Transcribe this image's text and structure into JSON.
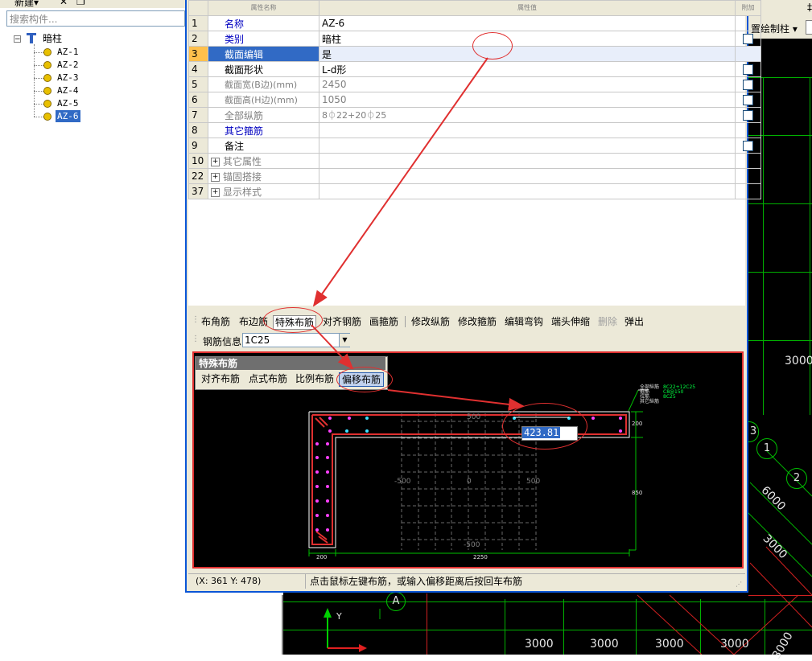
{
  "left_panel": {
    "toolbar_label": "新建",
    "search_placeholder": "搜索构件...",
    "tree_root": "暗柱",
    "tree_items": [
      "AZ-1",
      "AZ-2",
      "AZ-3",
      "AZ-4",
      "AZ-5",
      "AZ-6"
    ],
    "selected_item": "AZ-6"
  },
  "cad": {
    "toolbar_label": "置绘制柱",
    "dims": [
      "3000",
      "6000",
      "3000",
      "3000",
      "3000",
      "3000",
      "3000",
      "3000"
    ],
    "axis_labels": [
      "1",
      "2",
      "3",
      "A"
    ],
    "coord_axis_y": "Y"
  },
  "property_grid": {
    "header_name": "属性名称",
    "header_value": "属性值",
    "header_add": "附加",
    "rows": [
      {
        "num": "1",
        "name": "名称",
        "value": "AZ-6",
        "style": "blue",
        "check": false
      },
      {
        "num": "2",
        "name": "类别",
        "value": "暗柱",
        "style": "blue",
        "check": true
      },
      {
        "num": "3",
        "name": "截面编辑",
        "value": "是",
        "style": "sel",
        "check": false
      },
      {
        "num": "4",
        "name": "截面形状",
        "value": "L-d形",
        "style": "black",
        "check": true
      },
      {
        "num": "5",
        "name": "截面宽(B边)(mm)",
        "value": "2450",
        "style": "gray",
        "check": true
      },
      {
        "num": "6",
        "name": "截面高(H边)(mm)",
        "value": "1050",
        "style": "gray",
        "check": true
      },
      {
        "num": "7",
        "name": "全部纵筋",
        "value": "8⏀22+20⏀25",
        "style": "gray",
        "check": true
      },
      {
        "num": "8",
        "name": "其它箍筋",
        "value": "",
        "style": "blue",
        "check": false
      },
      {
        "num": "9",
        "name": "备注",
        "value": "",
        "style": "black",
        "check": true
      },
      {
        "num": "10",
        "name": "其它属性",
        "value": "",
        "style": "group",
        "check": false
      },
      {
        "num": "22",
        "name": "锚固搭接",
        "value": "",
        "style": "group",
        "check": false
      },
      {
        "num": "37",
        "name": "显示样式",
        "value": "",
        "style": "group",
        "check": false
      }
    ]
  },
  "toolbar": {
    "items": [
      "布角筋",
      "布边筋",
      "特殊布筋",
      "对齐钢筋",
      "画箍筋",
      "修改纵筋",
      "修改箍筋",
      "编辑弯钩",
      "端头伸缩",
      "删除",
      "弹出"
    ],
    "active": "特殊布筋",
    "disabled": "删除"
  },
  "rebar_info": {
    "label": "钢筋信息",
    "value": "1C25"
  },
  "special_popup": {
    "title": "特殊布筋",
    "buttons": [
      "对齐布筋",
      "点式布筋",
      "比例布筋",
      "偏移布筋"
    ],
    "active": "偏移布筋"
  },
  "drawing": {
    "input_value": "423.81",
    "dim_top": "200",
    "dim_right": "850",
    "dim_bottom_left": "200",
    "dim_bottom": "2250",
    "grid_labels": [
      "500",
      "-500",
      "0",
      "500",
      "-500"
    ],
    "legend_lines": [
      "全部纵筋",
      "箍筋",
      "拉筋",
      "其它纵筋"
    ],
    "legend_values": [
      "8C22+12C25",
      "C8@150",
      "",
      "8C25"
    ]
  },
  "status": {
    "coords": "(X: 361 Y: 478)",
    "message": "点击鼠标左键布筋，或输入偏移距离后按回车布筋"
  },
  "colors": {
    "selection": "#316ac5",
    "annotation_red": "#e03030",
    "rebar_highlight": "#e03030",
    "cad_green": "#00b000"
  }
}
